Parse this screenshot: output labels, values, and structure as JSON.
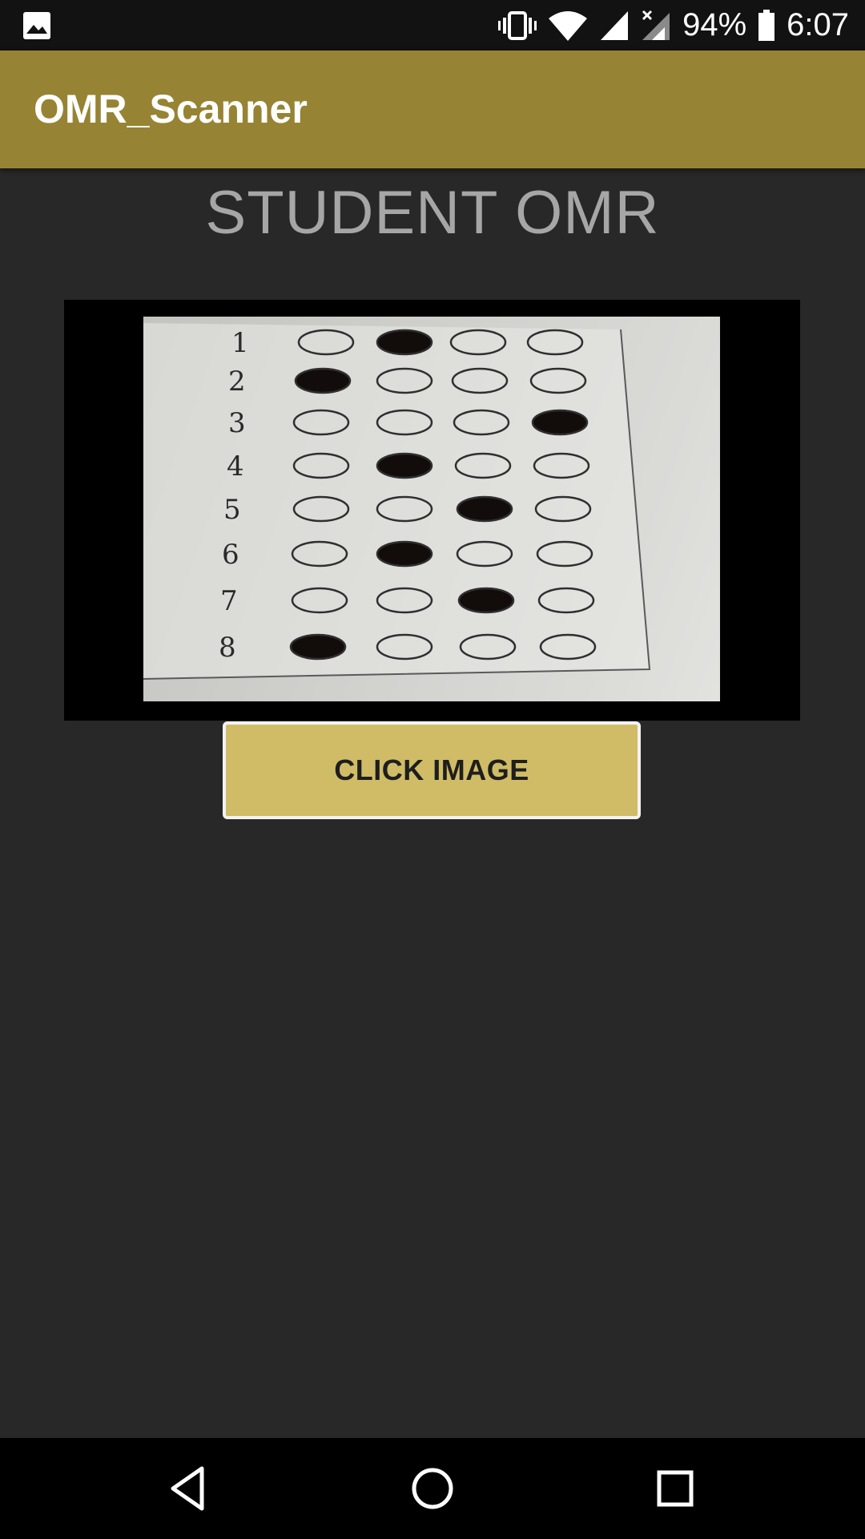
{
  "status_bar": {
    "battery": "94%",
    "time": "6:07",
    "icons": [
      "image-icon",
      "vibrate-icon",
      "wifi-icon",
      "signal-icon",
      "signal-off-icon",
      "battery-icon"
    ]
  },
  "app_bar": {
    "title": "OMR_Scanner",
    "color": "#968434"
  },
  "main": {
    "heading": "STUDENT OMR",
    "omr_sheet": {
      "question_numbers": [
        "1",
        "2",
        "3",
        "4",
        "5",
        "6",
        "7",
        "8"
      ],
      "filled_option_index": [
        1,
        0,
        3,
        1,
        2,
        1,
        2,
        0
      ]
    },
    "click_button_label": "CLICK IMAGE",
    "button_color": "#d0bc66"
  },
  "nav_bar": {
    "icons": [
      "back-icon",
      "home-icon",
      "recents-icon"
    ]
  }
}
